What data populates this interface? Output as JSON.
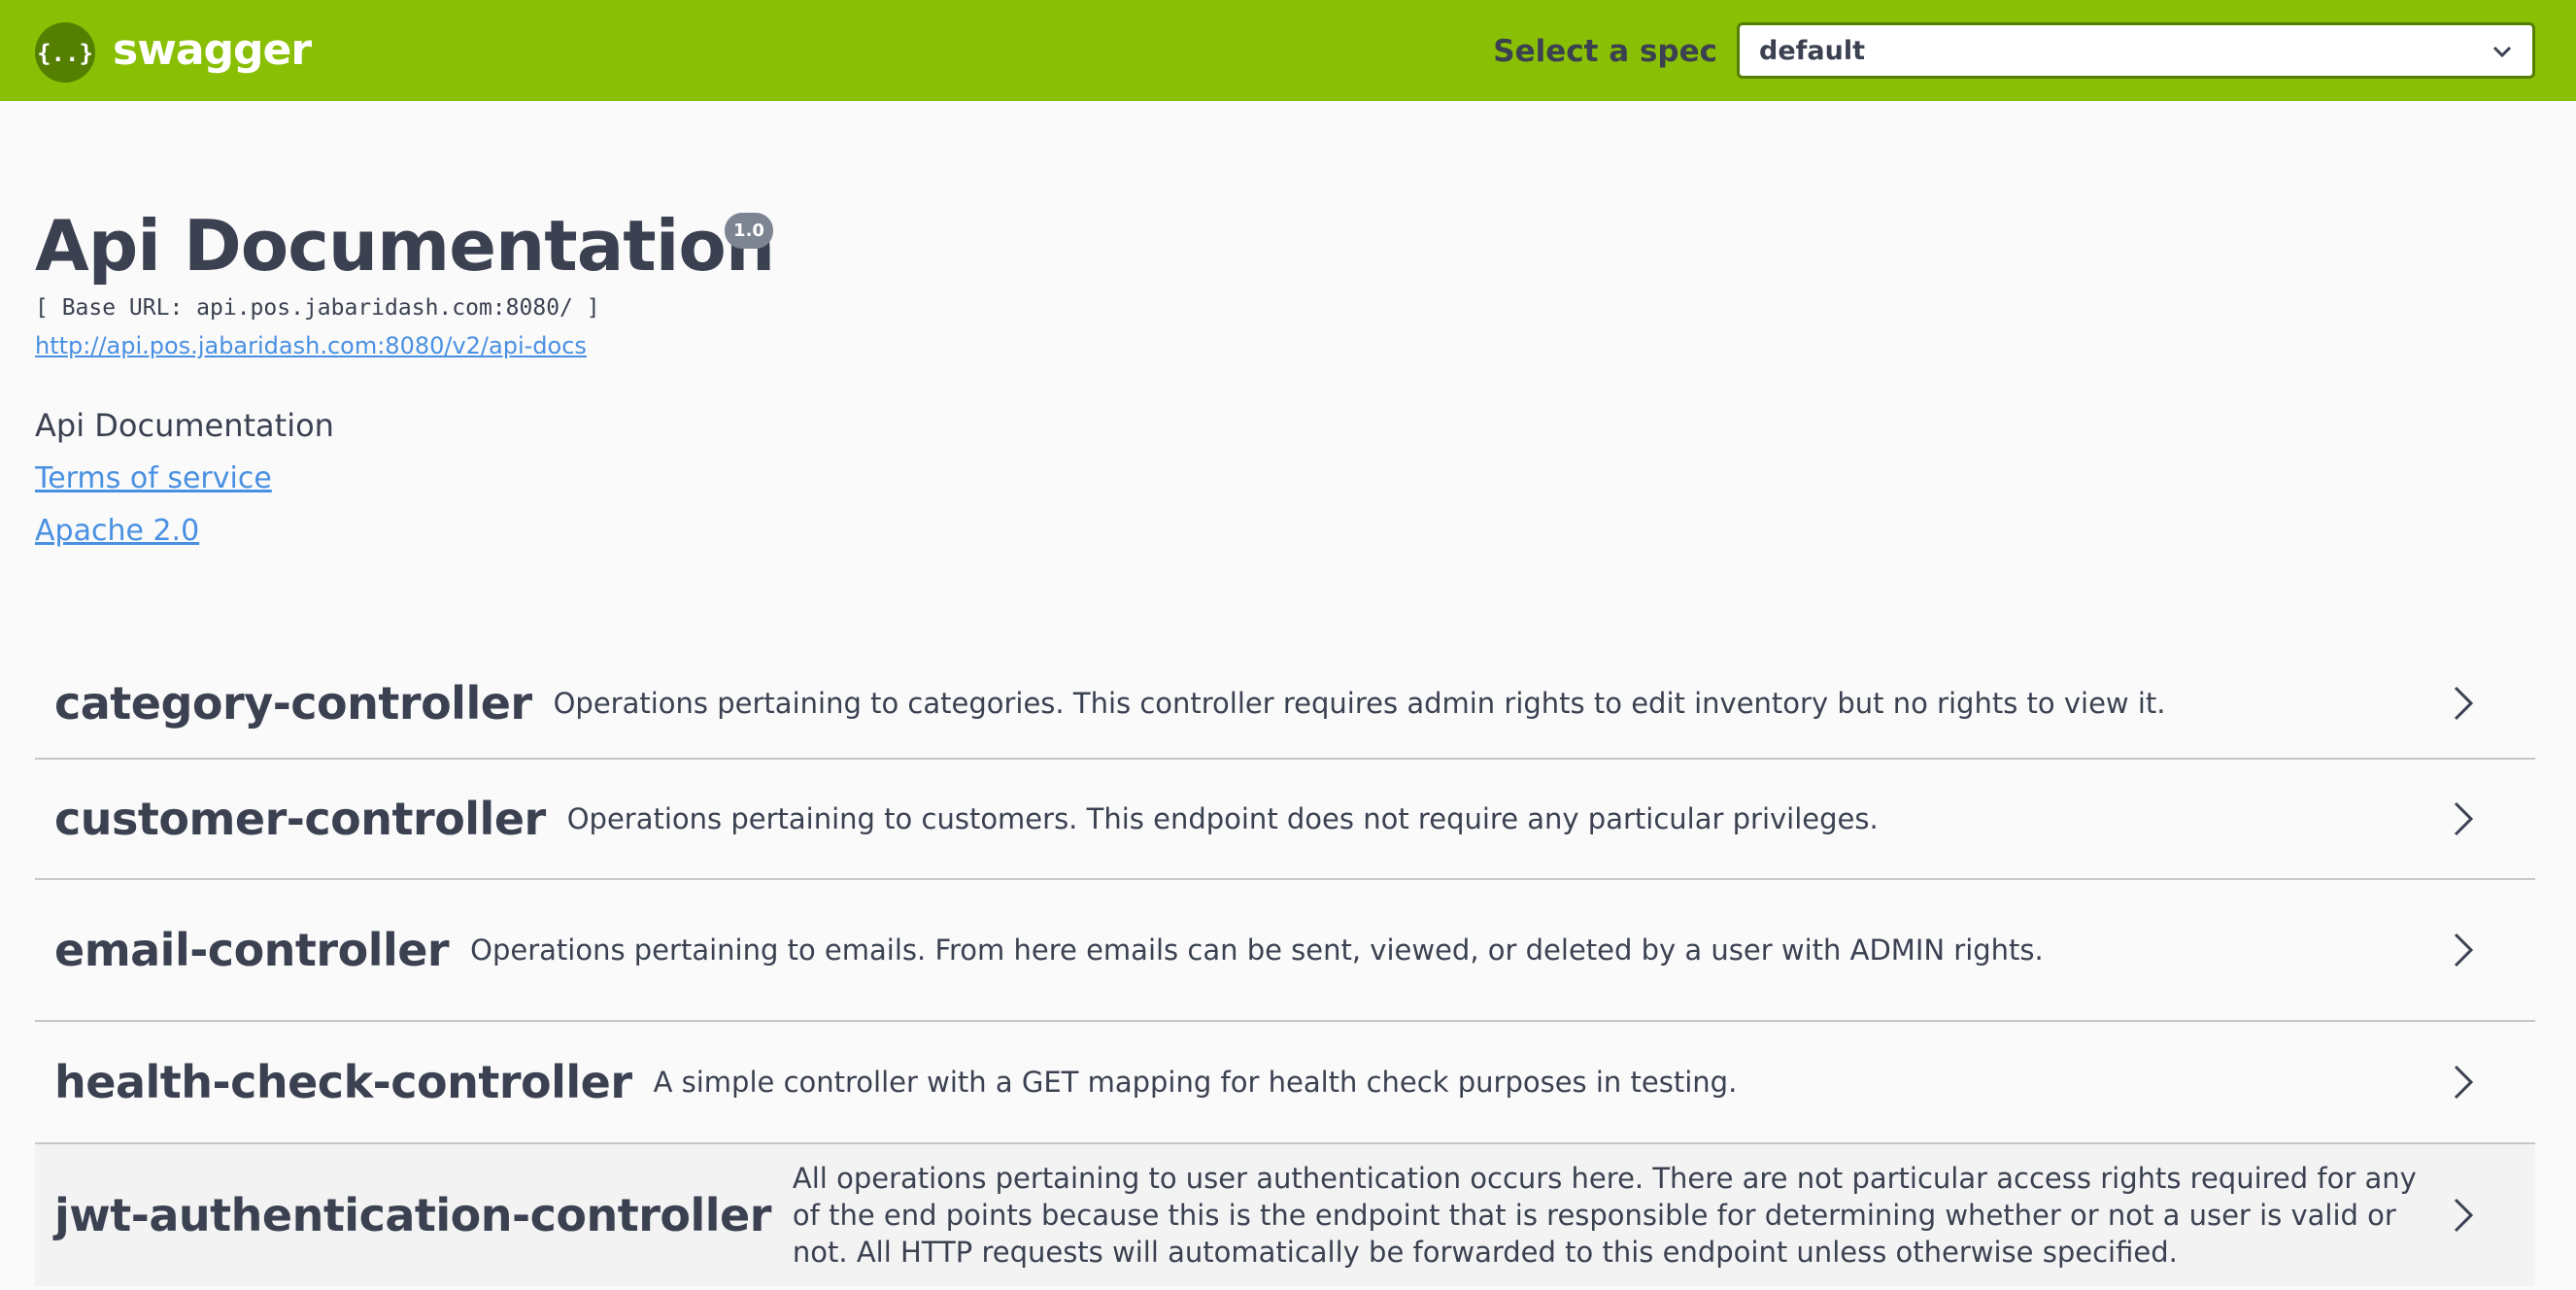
{
  "topbar": {
    "logo_text": "swagger",
    "logo_icon": "swagger-braces-icon",
    "spec_label": "Select a spec",
    "spec_selected": "default",
    "color": "#89bf04"
  },
  "info": {
    "title": "Api Documentation",
    "version": "1.0",
    "base_url": "[ Base URL: api.pos.jabaridash.com:8080/ ]",
    "docs_url": "http://api.pos.jabaridash.com:8080/v2/api-docs",
    "description": "Api Documentation",
    "terms_label": "Terms of service",
    "license_label": "Apache 2.0"
  },
  "tags": [
    {
      "name": "category-controller",
      "description": "Operations pertaining to categories. This controller requires admin rights to edit inventory but no rights to view it."
    },
    {
      "name": "customer-controller",
      "description": "Operations pertaining to customers. This endpoint does not require any particular privileges."
    },
    {
      "name": "email-controller",
      "description": "Operations pertaining to emails. From here emails can be sent, viewed, or deleted by a user with ADMIN rights."
    },
    {
      "name": "health-check-controller",
      "description": "A simple controller with a GET mapping for health check purposes in testing."
    },
    {
      "name": "jwt-authentication-controller",
      "description": "All operations pertaining to user authentication occurs here. There are not particular access rights required for any of the end points because this is the endpoint that is responsible for determining whether or not a user is valid or not. All HTTP requests will automatically be forwarded to this endpoint unless otherwise specified."
    }
  ]
}
